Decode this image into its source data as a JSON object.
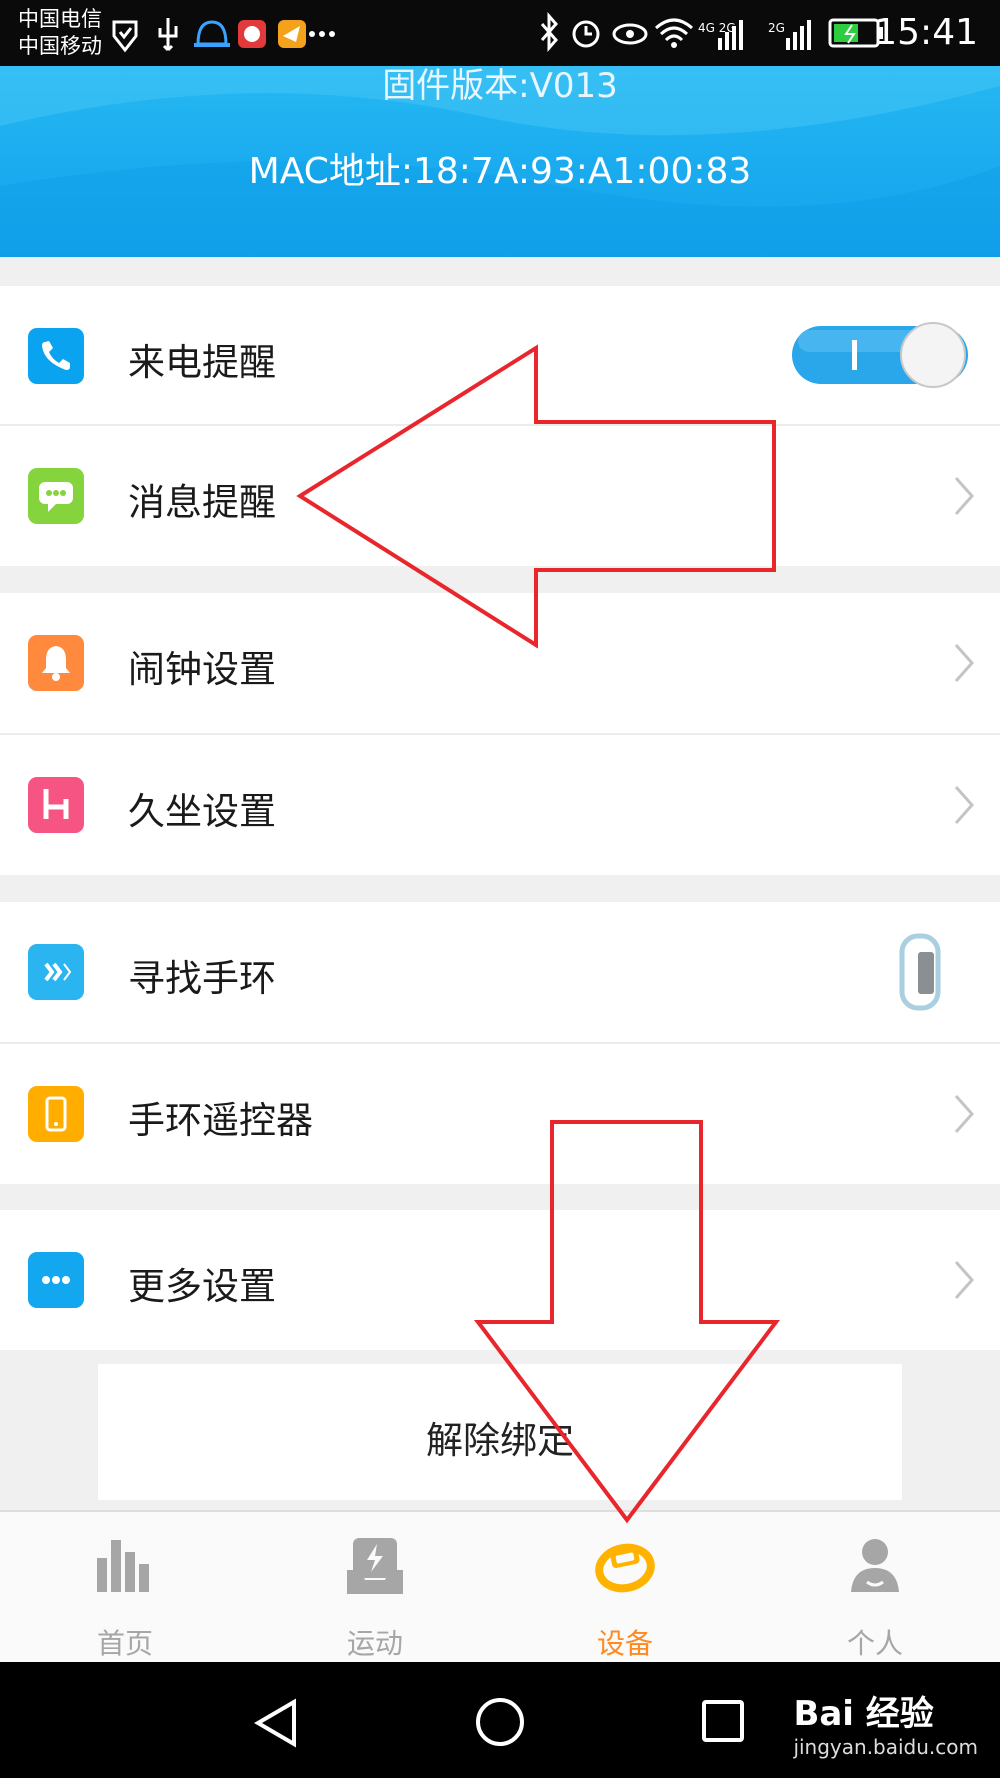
{
  "status_bar": {
    "carrier_1": "中国电信",
    "carrier_2": "中国移动",
    "signal_1": "4G 2G",
    "signal_2": "2G",
    "time": "15:41"
  },
  "header": {
    "firmware": "固件版本:V013",
    "mac": "MAC地址:18:7A:93:A1:00:83"
  },
  "settings": [
    {
      "label": "来电提醒",
      "icon": "phone-icon",
      "color": "#0aa3f0",
      "control": "toggle",
      "toggle_on": true
    },
    {
      "label": "消息提醒",
      "icon": "chat-icon",
      "color": "#85d33d",
      "control": "chevron"
    },
    {
      "label": "闹钟设置",
      "icon": "bell-icon",
      "color": "#ff8a3d",
      "control": "chevron"
    },
    {
      "label": "久坐设置",
      "icon": "chair-icon",
      "color": "#f65483",
      "control": "chevron"
    },
    {
      "label": "寻找手环",
      "icon": "signal-icon",
      "color": "#2ab5f0",
      "control": "band-image"
    },
    {
      "label": "手环遥控器",
      "icon": "phone-device-icon",
      "color": "#ffae00",
      "control": "chevron"
    },
    {
      "label": "更多设置",
      "icon": "dots-icon",
      "color": "#12a7ef",
      "control": "chevron"
    }
  ],
  "unbind_button": "解除绑定",
  "tabs": [
    {
      "label": "首页",
      "icon": "bar-chart-icon",
      "active": false
    },
    {
      "label": "运动",
      "icon": "lightning-tray-icon",
      "active": false
    },
    {
      "label": "设备",
      "icon": "band-icon",
      "active": true
    },
    {
      "label": "个人",
      "icon": "person-icon",
      "active": false
    }
  ],
  "watermark": {
    "brand": "Bai 经验",
    "url": "jingyan.baidu.com"
  },
  "colors": {
    "header_blue": "#1aabef",
    "active_tab": "#ff8a1f",
    "annotation_red": "#e8262b"
  }
}
